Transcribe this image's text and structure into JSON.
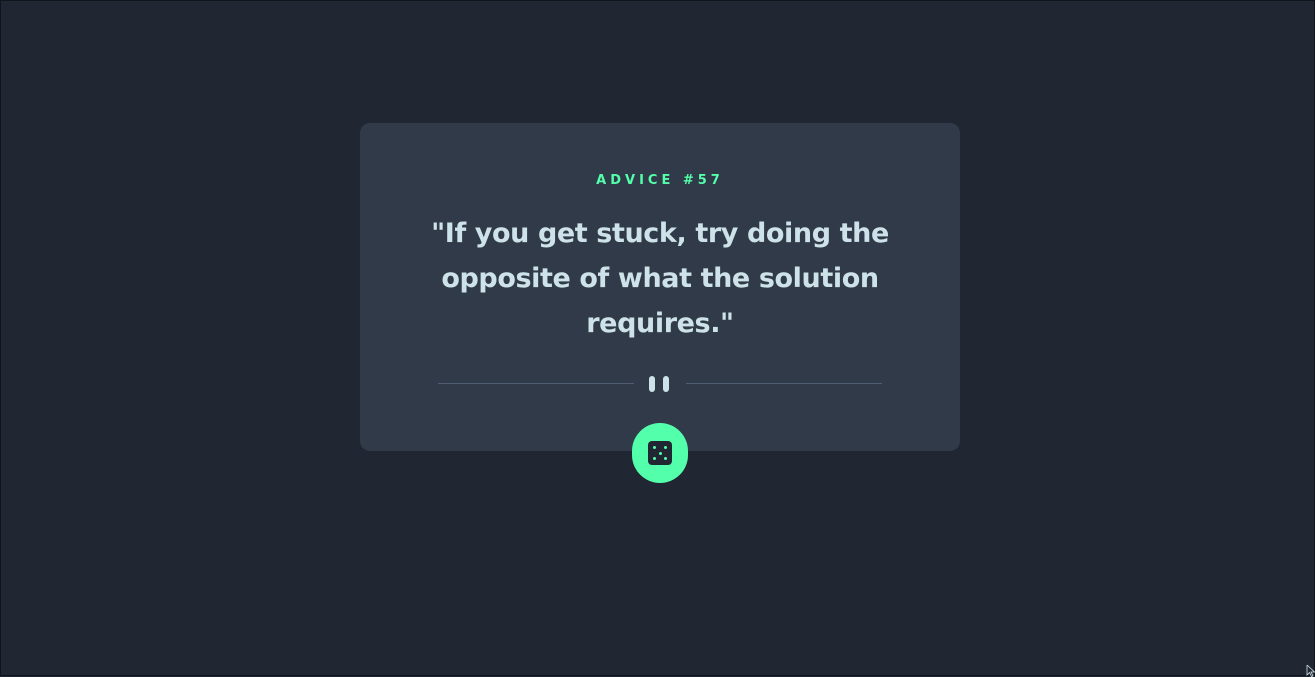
{
  "advice": {
    "label": "ADVICE #57",
    "quote": "\"If you get stuck, try doing the opposite of what the solution requires.\""
  },
  "icons": {
    "divider": "pause-icon",
    "button": "dice-icon"
  },
  "colors": {
    "background": "#202632",
    "card": "#313a48",
    "accent": "#53ffaa",
    "text": "#cee3e9",
    "divider": "#4f5d74"
  }
}
